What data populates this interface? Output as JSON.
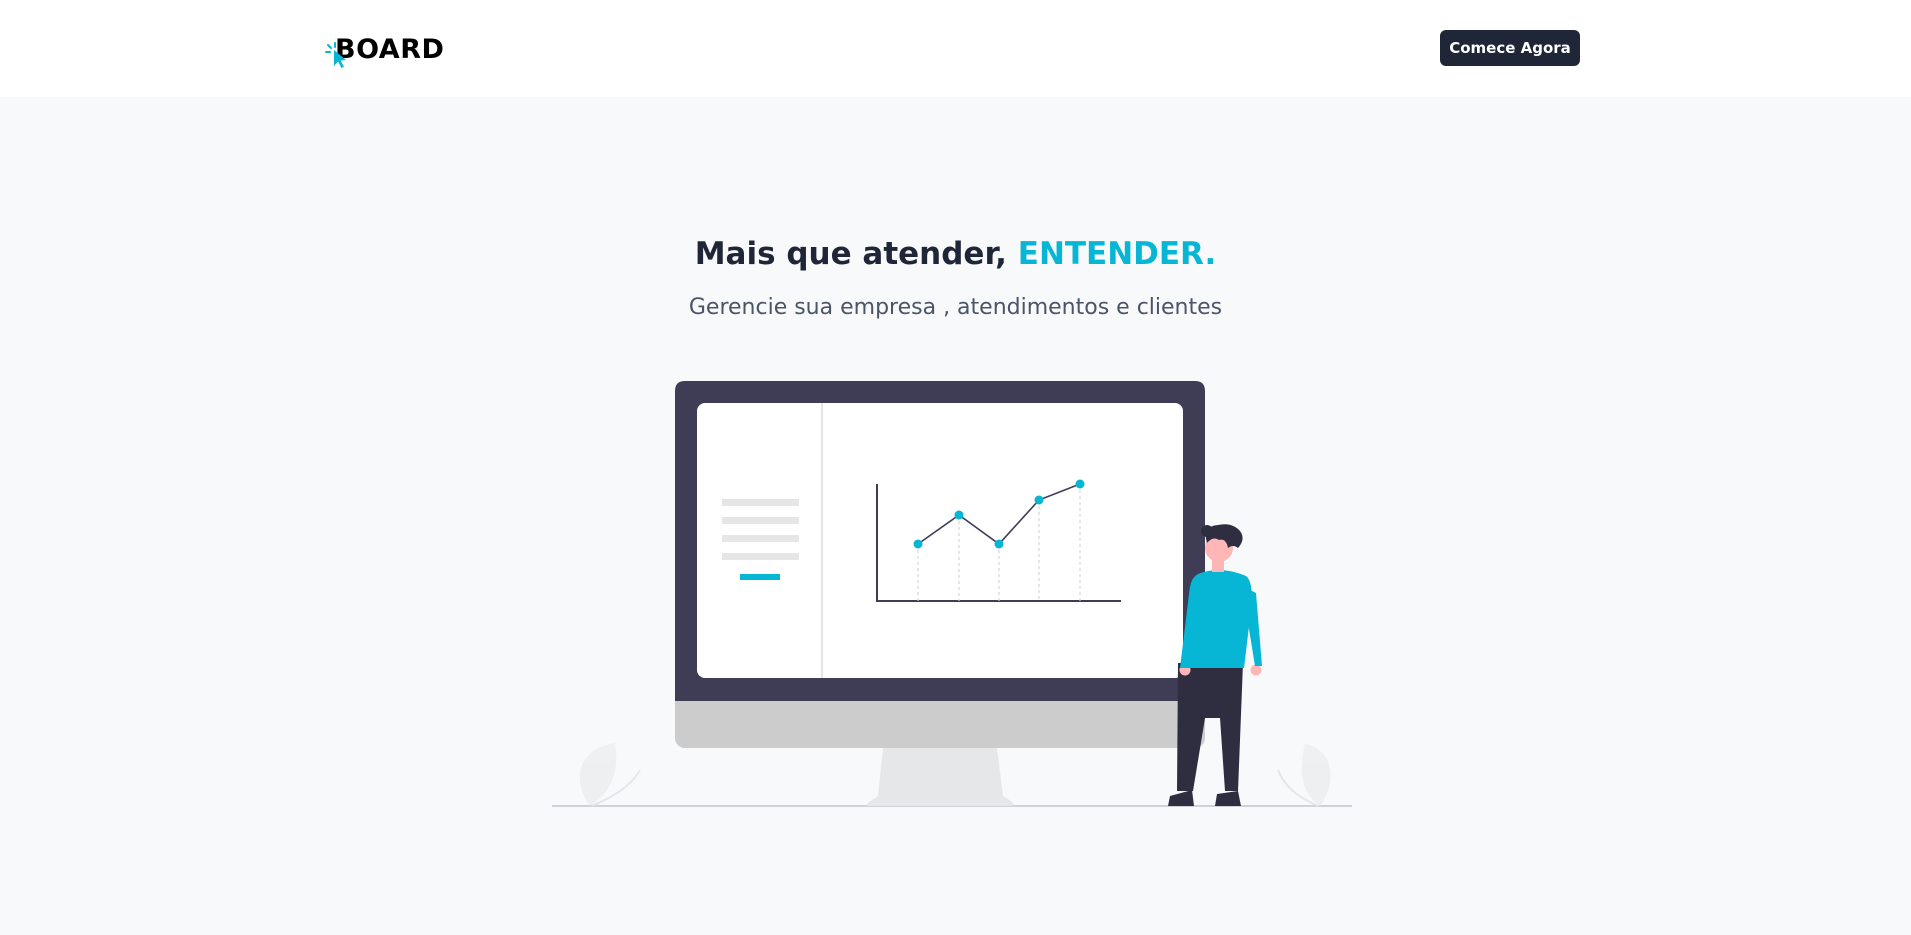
{
  "header": {
    "logo_text": "BOARD",
    "cta_label": "Comece Agora"
  },
  "hero": {
    "title_main": "Mais que atender, ",
    "title_accent": "ENTENDER.",
    "subtitle": "Gerencie sua empresa , atendimentos e clientes"
  },
  "colors": {
    "accent": "#06b6d4",
    "dark": "#1e2637",
    "monitor_frame": "#3f3d56",
    "background": "#f8f9fb"
  },
  "illustration": {
    "icon": "dashboard-illustration"
  }
}
